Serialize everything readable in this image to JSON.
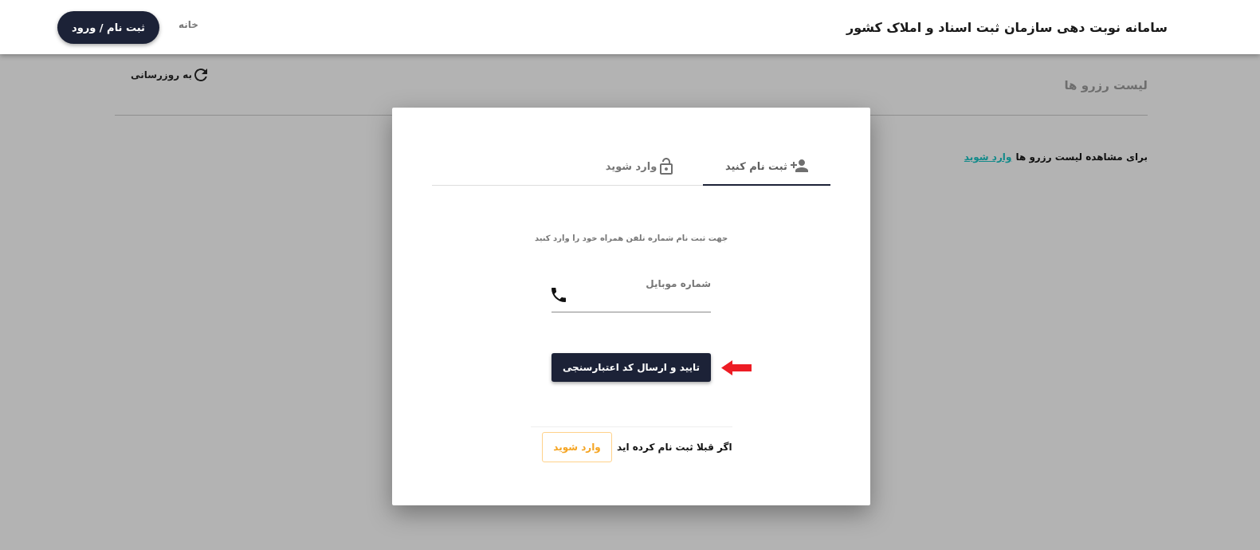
{
  "header": {
    "title": "سامانه نوبت دهی سازمان ثبت اسناد و املاک کشور",
    "nav_link": "خانه",
    "auth_button": "ثبت نام / ورود"
  },
  "background_page": {
    "title": "لیست رزرو ها",
    "refresh_button": "به روزرسانی",
    "notice": {
      "text": "برای مشاهده لیست رزرو ها",
      "link": "وارد شوید"
    }
  },
  "modal": {
    "tabs": [
      {
        "kind": "register",
        "label": "ثبت نام کنید",
        "selected": true
      },
      {
        "kind": "login",
        "label": "وارد شوید",
        "selected": false
      }
    ],
    "instruction": "جهت ثبت نام شماره تلفن همراه خود را وارد کنید",
    "mobile_field": {
      "placeholder": "شماره موبایل"
    },
    "submit_button": "تایید و ارسال کد اعتبارسنجی",
    "footer": {
      "text": "اگر قبلا ثبت نام کرده اید",
      "login_button": "وارد شوید"
    }
  }
}
